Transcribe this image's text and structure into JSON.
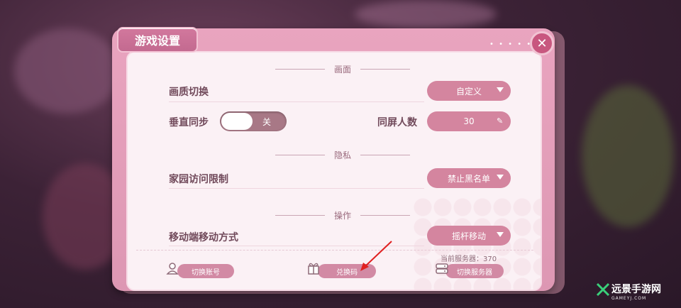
{
  "window": {
    "title": "游戏设置"
  },
  "sections": {
    "graphics": "画面",
    "privacy": "隐私",
    "controls": "操作"
  },
  "settings": {
    "quality": {
      "label": "画质切换",
      "value": "自定义"
    },
    "vsync": {
      "label": "垂直同步",
      "value": "关"
    },
    "players_on_screen": {
      "label": "同屏人数",
      "value": "30"
    },
    "home_visit": {
      "label": "家园访问限制",
      "value": "禁止黑名单"
    },
    "mobile_move": {
      "label": "移动端移动方式",
      "value": "摇杆移动"
    }
  },
  "footer": {
    "server": "当前服务器：370",
    "switch_account": "切换账号",
    "redeem_code": "兑换码",
    "switch_server": "切换服务器"
  },
  "watermark": {
    "name": "远景手游网",
    "url": "GAMEYJ.COM"
  },
  "colors": {
    "accent": "#d4859f",
    "title_bg": "#c36a90",
    "close": "#c8577f",
    "text": "#714a5b"
  },
  "icons": [
    "close-icon",
    "caret-down-icon",
    "pencil-icon",
    "account-icon",
    "gift-icon",
    "server-icon",
    "arrow-annotation"
  ]
}
